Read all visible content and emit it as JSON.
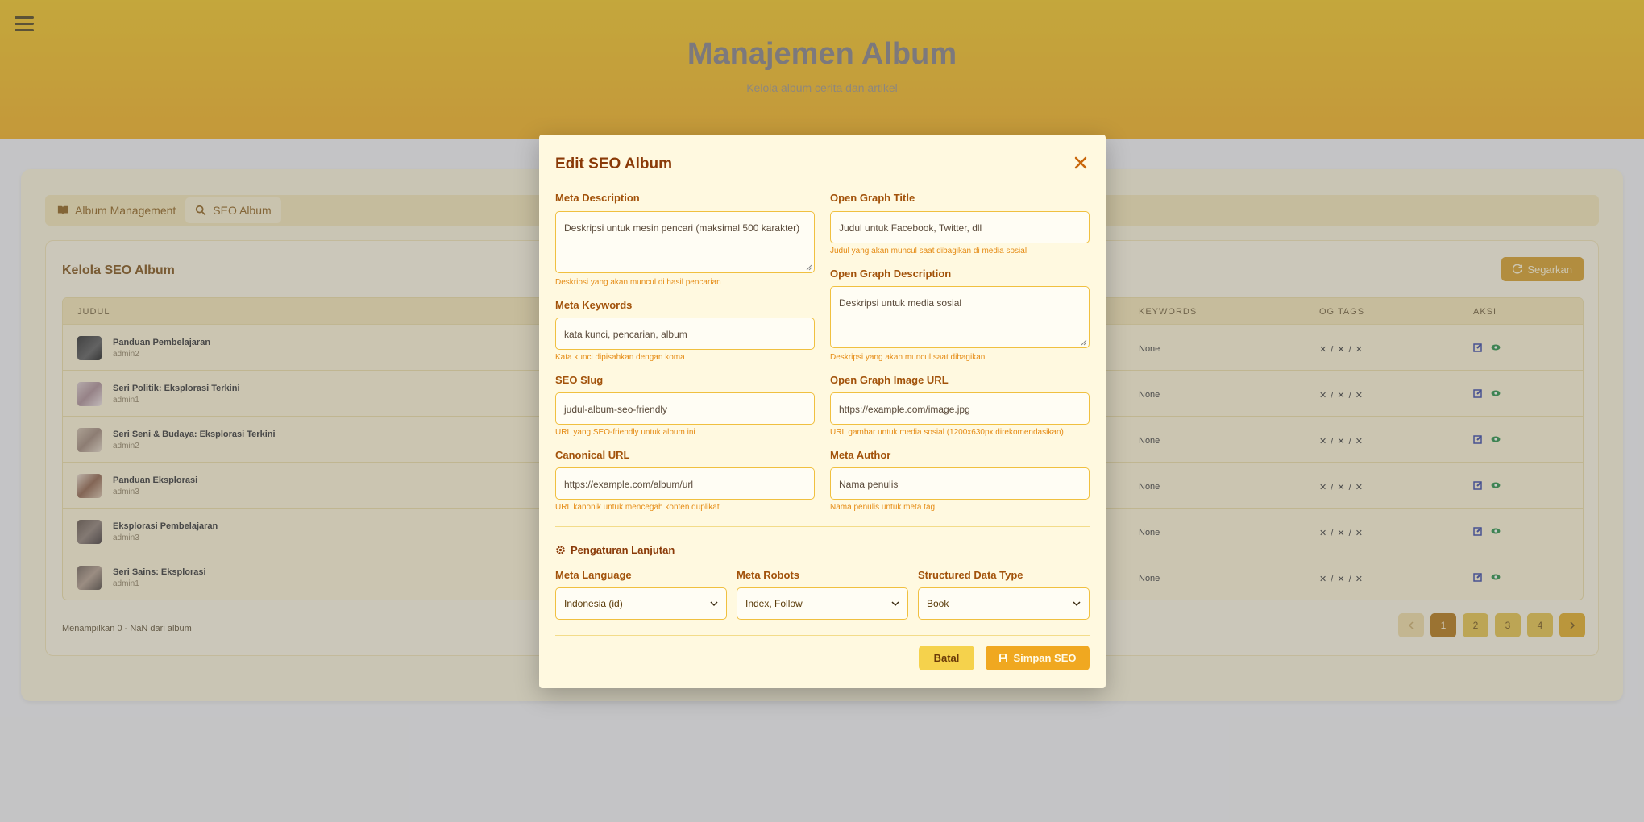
{
  "page": {
    "title": "Manajemen Album",
    "subtitle": "Kelola album cerita dan artikel"
  },
  "tabs": [
    {
      "label": "Album Management",
      "icon": "book-icon"
    },
    {
      "label": "SEO Album",
      "icon": "search-icon"
    }
  ],
  "panel": {
    "title": "Kelola SEO Album",
    "refresh_label": "Segarkan"
  },
  "table": {
    "headers": [
      "JUDUL",
      "KEYWORDS",
      "OG TAGS",
      "AKSI"
    ],
    "rows": [
      {
        "title": "Panduan Pembelajaran",
        "author": "admin2",
        "keywords": "None",
        "og": "✕ / ✕ / ✕"
      },
      {
        "title": "Seri Politik: Eksplorasi Terkini",
        "author": "admin1",
        "keywords": "None",
        "og": "✕ / ✕ / ✕"
      },
      {
        "title": "Seri Seni & Budaya: Eksplorasi Terkini",
        "author": "admin2",
        "keywords": "None",
        "og": "✕ / ✕ / ✕"
      },
      {
        "title": "Panduan Eksplorasi",
        "author": "admin3",
        "keywords": "None",
        "og": "✕ / ✕ / ✕"
      },
      {
        "title": "Eksplorasi Pembelajaran",
        "author": "admin3",
        "keywords": "None",
        "og": "✕ / ✕ / ✕"
      },
      {
        "title": "Seri Sains: Eksplorasi",
        "author": "admin1",
        "keywords": "None",
        "og": "✕ / ✕ / ✕"
      }
    ]
  },
  "footer": {
    "showing": "Menampilkan 0 - NaN dari album",
    "pages": [
      "1",
      "2",
      "3",
      "4"
    ]
  },
  "modal": {
    "title": "Edit SEO Album",
    "meta_description": {
      "label": "Meta Description",
      "placeholder": "Deskripsi untuk mesin pencari (maksimal 500 karakter)",
      "hint": "Deskripsi yang akan muncul di hasil pencarian"
    },
    "meta_keywords": {
      "label": "Meta Keywords",
      "placeholder": "kata kunci, pencarian, album",
      "hint": "Kata kunci dipisahkan dengan koma"
    },
    "seo_slug": {
      "label": "SEO Slug",
      "placeholder": "judul-album-seo-friendly",
      "hint": "URL yang SEO-friendly untuk album ini"
    },
    "canonical_url": {
      "label": "Canonical URL",
      "placeholder": "https://example.com/album/url",
      "hint": "URL kanonik untuk mencegah konten duplikat"
    },
    "og_title": {
      "label": "Open Graph Title",
      "placeholder": "Judul untuk Facebook, Twitter, dll",
      "hint": "Judul yang akan muncul saat dibagikan di media sosial"
    },
    "og_description": {
      "label": "Open Graph Description",
      "placeholder": "Deskripsi untuk media sosial",
      "hint": "Deskripsi yang akan muncul saat dibagikan"
    },
    "og_image": {
      "label": "Open Graph Image URL",
      "placeholder": "https://example.com/image.jpg",
      "hint": "URL gambar untuk media sosial (1200x630px direkomendasikan)"
    },
    "meta_author": {
      "label": "Meta Author",
      "placeholder": "Nama penulis",
      "hint": "Nama penulis untuk meta tag"
    },
    "advanced_title": "Pengaturan Lanjutan",
    "meta_language": {
      "label": "Meta Language",
      "value": "Indonesia (id)"
    },
    "meta_robots": {
      "label": "Meta Robots",
      "value": "Index, Follow"
    },
    "structured_data": {
      "label": "Structured Data Type",
      "value": "Book"
    },
    "cancel_label": "Batal",
    "save_label": "Simpan SEO"
  },
  "colors": {
    "accent": "#f0a820",
    "title": "#8a3a08",
    "hint": "#e58b14",
    "header_gradient_top": "#f3c317",
    "header_gradient_bottom": "#f2ac14"
  }
}
